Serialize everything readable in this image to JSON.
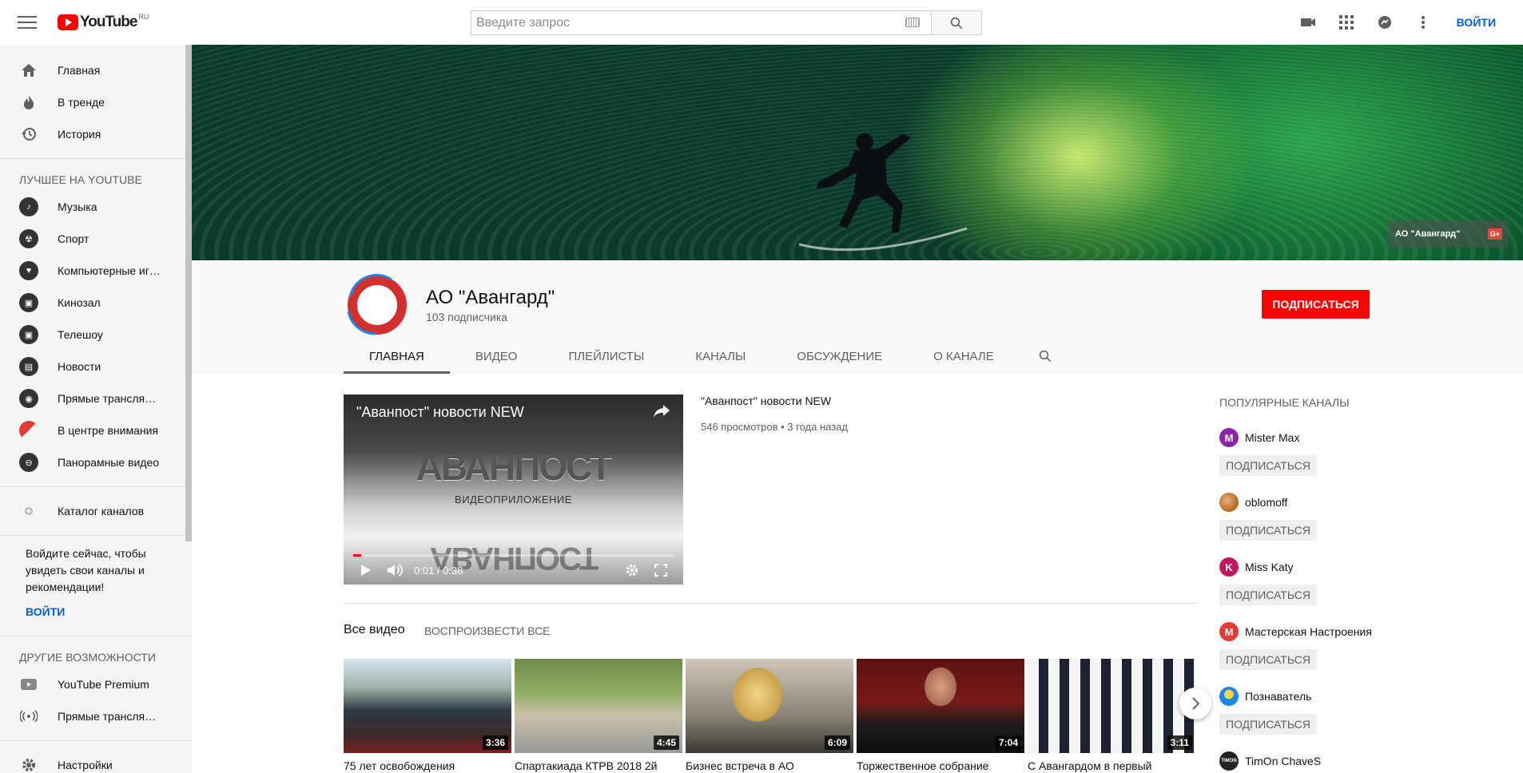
{
  "header": {
    "logo_text": "YouTube",
    "logo_region": "RU",
    "search_placeholder": "Введите запрос",
    "login_label": "ВОЙТИ"
  },
  "sidebar": {
    "main": [
      {
        "label": "Главная",
        "icon": "home-icon"
      },
      {
        "label": "В тренде",
        "icon": "flame-icon"
      },
      {
        "label": "История",
        "icon": "history-icon"
      }
    ],
    "best_heading": "ЛУЧШЕЕ НА YOUTUBE",
    "best": [
      {
        "label": "Музыка",
        "icon": "music-icon"
      },
      {
        "label": "Спорт",
        "icon": "sport-icon"
      },
      {
        "label": "Компьютерные игры",
        "icon": "gaming-icon"
      },
      {
        "label": "Кинозал",
        "icon": "film-icon"
      },
      {
        "label": "Телешоу",
        "icon": "tv-icon"
      },
      {
        "label": "Новости",
        "icon": "news-icon"
      },
      {
        "label": "Прямые трансляции",
        "icon": "live-icon"
      },
      {
        "label": "В центре внимания",
        "icon": "spotlight-icon"
      },
      {
        "label": "Панорамные видео",
        "icon": "360-icon"
      }
    ],
    "catalog": {
      "label": "Каталог каналов",
      "icon": "add-circle-icon"
    },
    "signin_text": "Войдите сейчас, чтобы увидеть свои каналы и рекомендации!",
    "signin_link": "ВОЙТИ",
    "more_heading": "ДРУГИЕ ВОЗМОЖНОСТИ",
    "more": [
      {
        "label": "YouTube Premium",
        "icon": "youtube-icon"
      },
      {
        "label": "Прямые трансляции",
        "icon": "broadcast-icon"
      }
    ],
    "settings": {
      "label": "Настройки",
      "icon": "gear-icon"
    }
  },
  "banner": {
    "channel_link": "АО \"Авангард\"",
    "gplus": "G+"
  },
  "channel": {
    "title": "АО \"Авангард\"",
    "subscribers": "103 подписчика",
    "subscribe_label": "ПОДПИСАТЬСЯ",
    "tabs": [
      "ГЛАВНАЯ",
      "ВИДЕО",
      "ПЛЕЙЛИСТЫ",
      "КАНАЛЫ",
      "ОБСУЖДЕНИЕ",
      "О КАНАЛЕ"
    ],
    "active_tab": "ГЛАВНАЯ"
  },
  "featured": {
    "player_title": "\"Аванпост\" новости NEW",
    "player_logo": "АВАНПОСТ",
    "player_sub": "ВИДЕОПРИЛОЖЕНИЕ",
    "time": "0:01 / 0:38",
    "progress": 0.026,
    "title": "\"Аванпост\" новости NEW",
    "meta": "546 просмотров • 3 года назад"
  },
  "shelf": {
    "title": "Все видео",
    "play_all": "ВОСПРОИЗВЕСТИ ВСЕ",
    "videos": [
      {
        "title": "75 лет освобождения",
        "duration": "3:36"
      },
      {
        "title": "Спартакиада КТРВ 2018 2й",
        "duration": "4:45"
      },
      {
        "title": "Бизнес встреча в АО",
        "duration": "6:09"
      },
      {
        "title": "Торжественное собрание",
        "duration": "7:04"
      },
      {
        "title": "С Авангардом в первый",
        "duration": "3:11"
      }
    ]
  },
  "popular": {
    "heading": "ПОПУЛЯРНЫЕ КАНАЛЫ",
    "subscribe_label": "ПОДПИСАТЬСЯ",
    "channels": [
      {
        "name": "Mister Max",
        "letter": "M",
        "color": "#8e24aa"
      },
      {
        "name": "oblomoff",
        "letter": "",
        "color": "#b5651d"
      },
      {
        "name": "Miss Katy",
        "letter": "K",
        "color": "#c2185b"
      },
      {
        "name": "Мастерская Настроения",
        "letter": "M",
        "color": "#e53935"
      },
      {
        "name": "Познаватель",
        "letter": "",
        "color": "#1e88e5"
      },
      {
        "name": "TimOn ChaveS",
        "letter": "TIMON",
        "color": "#222222"
      }
    ]
  },
  "colors": {
    "accent": "#ff0000",
    "link": "#065fd4"
  }
}
